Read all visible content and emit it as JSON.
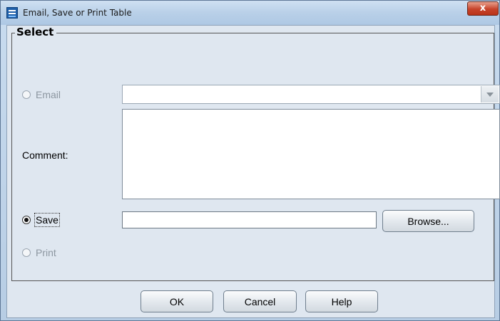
{
  "window": {
    "title": "Email, Save or Print Table",
    "close_label": "x"
  },
  "group": {
    "title": "Select"
  },
  "options": {
    "email": {
      "label": "Email",
      "checked": false,
      "enabled": false
    },
    "comment_label": "Comment:",
    "save": {
      "label": "Save",
      "checked": true,
      "enabled": true
    },
    "print": {
      "label": "Print",
      "checked": false,
      "enabled": false
    }
  },
  "fields": {
    "email_combo_value": "",
    "comment_value": "",
    "save_path_value": ""
  },
  "buttons": {
    "browse": "Browse...",
    "ok": "OK",
    "cancel": "Cancel",
    "help": "Help"
  }
}
